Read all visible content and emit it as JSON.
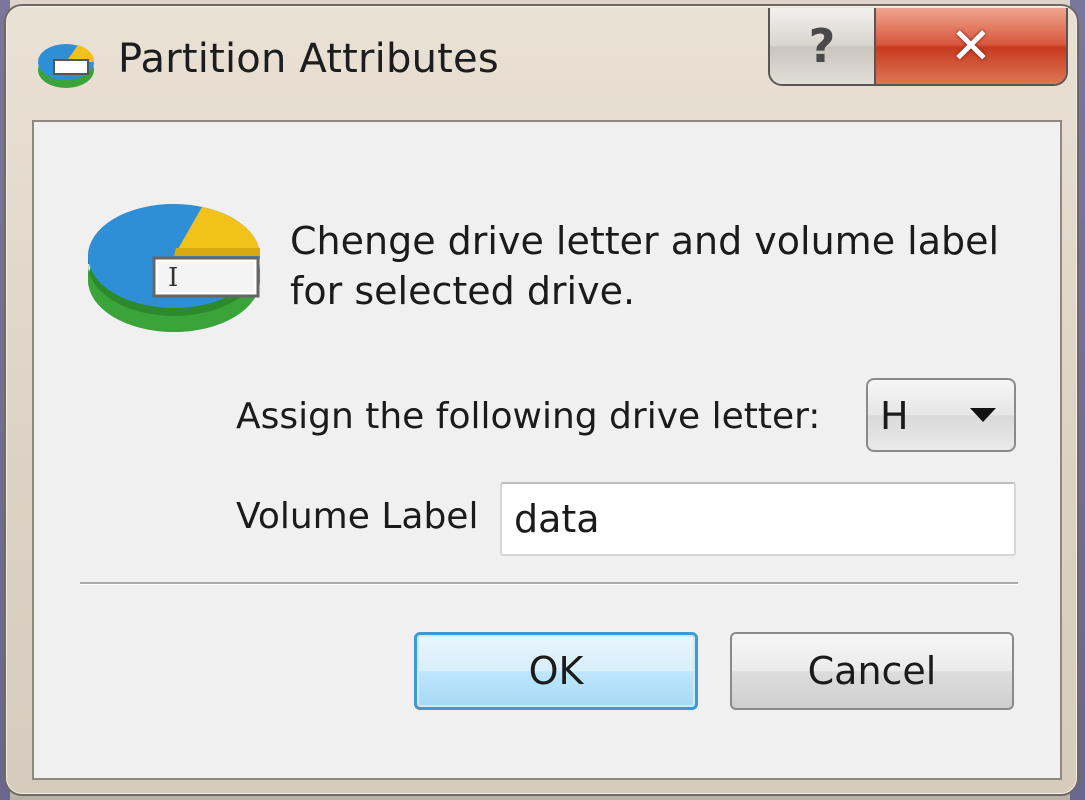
{
  "window": {
    "title": "Partition Attributes",
    "icon": "partition-attributes-icon",
    "help_label": "?",
    "close_label": "✕"
  },
  "dialog": {
    "icon": "drive-rename-icon",
    "description_line1": "Chenge drive letter and volume label",
    "description_line2": "for selected drive.",
    "drive_letter_label": "Assign the following drive letter:",
    "drive_letter_value": "H",
    "volume_label_label": "Volume Label",
    "volume_label_value": "data"
  },
  "buttons": {
    "ok_label": "OK",
    "cancel_label": "Cancel"
  },
  "colors": {
    "ok_accent": "#3c9bd6",
    "close_red": "#c73a1f",
    "pie_blue": "#2f8fd6",
    "pie_yellow": "#f2c21a",
    "pie_green": "#3aa43a"
  }
}
